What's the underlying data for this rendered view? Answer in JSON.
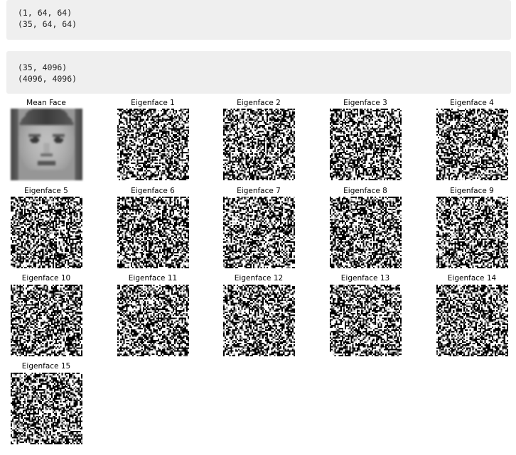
{
  "outputs": [
    {
      "lines": [
        "(1, 64, 64)",
        "(35, 64, 64)"
      ]
    },
    {
      "lines": [
        "(35, 4096)",
        "(4096, 4096)"
      ]
    }
  ],
  "faces": [
    {
      "title": "Mean Face",
      "kind": "mean"
    },
    {
      "title": "Eigenface 1",
      "kind": "noise",
      "seed": 11
    },
    {
      "title": "Eigenface 2",
      "kind": "noise",
      "seed": 23
    },
    {
      "title": "Eigenface 3",
      "kind": "noise",
      "seed": 37
    },
    {
      "title": "Eigenface 4",
      "kind": "noise",
      "seed": 41
    },
    {
      "title": "Eigenface 5",
      "kind": "noise",
      "seed": 53
    },
    {
      "title": "Eigenface 6",
      "kind": "noise",
      "seed": 67
    },
    {
      "title": "Eigenface 7",
      "kind": "noise",
      "seed": 71
    },
    {
      "title": "Eigenface 8",
      "kind": "noise",
      "seed": 83
    },
    {
      "title": "Eigenface 9",
      "kind": "noise",
      "seed": 97
    },
    {
      "title": "Eigenface 10",
      "kind": "noise",
      "seed": 101
    },
    {
      "title": "Eigenface 11",
      "kind": "noise",
      "seed": 113
    },
    {
      "title": "Eigenface 12",
      "kind": "noise",
      "seed": 127
    },
    {
      "title": "Eigenface 13",
      "kind": "noise",
      "seed": 131
    },
    {
      "title": "Eigenface 14",
      "kind": "noise",
      "seed": 149
    },
    {
      "title": "Eigenface 15",
      "kind": "noise",
      "seed": 157
    }
  ]
}
